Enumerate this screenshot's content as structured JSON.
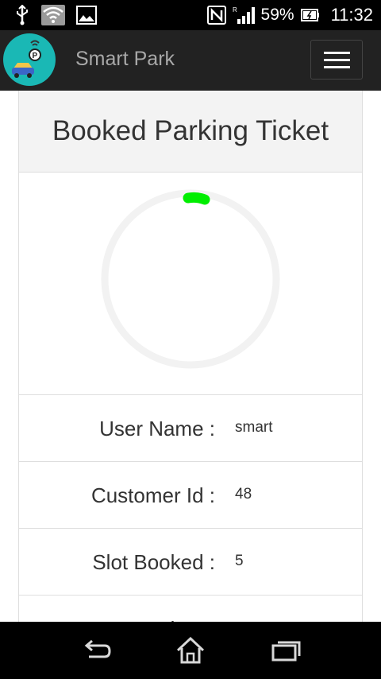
{
  "status_bar": {
    "battery_percent": "59%",
    "time": "11:32",
    "icons": [
      "usb-icon",
      "wifi-icon",
      "image-icon",
      "nfc-icon",
      "signal-icon",
      "battery-icon"
    ]
  },
  "app_bar": {
    "title": "Smart Park",
    "logo_icon": "parking-car-logo",
    "menu_icon": "hamburger-menu-icon"
  },
  "ticket": {
    "heading": "Booked Parking Ticket",
    "spinner_color": "#00ee00",
    "rows": [
      {
        "label": "User Name :",
        "value": "smart"
      },
      {
        "label": "Customer Id :",
        "value": "48"
      },
      {
        "label": "Slot Booked :",
        "value": "5"
      },
      {
        "label": "From Time :",
        "value": ""
      }
    ]
  },
  "nav_bar": {
    "icons": [
      "back-icon",
      "home-icon",
      "recent-apps-icon"
    ]
  },
  "colors": {
    "app_bar": "#222222",
    "logo_bg": "#1ab8b5",
    "header_bg": "#f3f3f3",
    "accent_green": "#00ee00"
  }
}
